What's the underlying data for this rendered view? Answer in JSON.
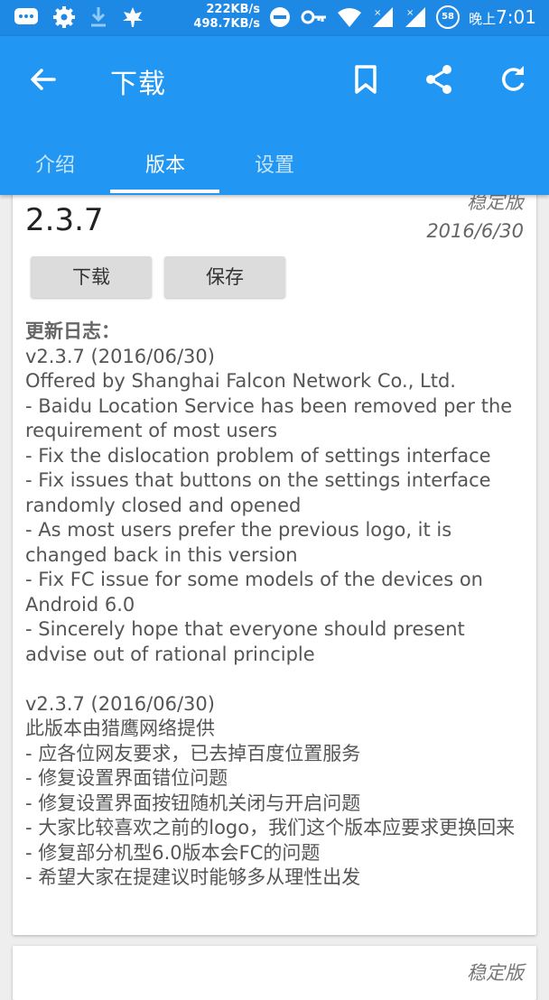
{
  "status_bar": {
    "net_up": "222KB/s",
    "net_down": "498.7KB/s",
    "battery": "58",
    "time_prefix": "晚上",
    "time": "7:01",
    "icons": [
      "chat-icon",
      "settings-icon",
      "download-icon",
      "leaf-icon",
      "dnd-icon",
      "key-icon",
      "wifi-icon",
      "signal-icon",
      "signal-icon"
    ]
  },
  "app_bar": {
    "title": "下载",
    "icons": [
      "back-arrow-icon",
      "bookmark-icon",
      "share-icon",
      "refresh-icon"
    ]
  },
  "tabs": [
    {
      "label": "介绍"
    },
    {
      "label": "版本"
    },
    {
      "label": "设置"
    }
  ],
  "release": {
    "stability": "稳定版",
    "version": "2.3.7",
    "date": "2016/6/30",
    "download_label": "下载",
    "save_label": "保存",
    "changelog_title": "更新日志：",
    "lines": [
      "v2.3.7 (2016/06/30)",
      "Offered by Shanghai Falcon Network Co., Ltd.",
      "- Baidu Location Service has been removed per the requirement of most users",
      "- Fix the dislocation problem of settings interface",
      "- Fix issues that buttons on the settings interface randomly closed and opened",
      "- As most users prefer the previous logo, it is changed back in this version",
      "- Fix FC issue for some models of the devices on Android 6.0",
      "- Sincerely hope that everyone should present advise out of rational principle",
      "",
      "v2.3.7 (2016/06/30)",
      "此版本由猎鹰网络提供",
      "- 应各位网友要求，已去掉百度位置服务",
      "- 修复设置界面错位问题",
      "- 修复设置界面按钮随机关闭与开启问题",
      "- 大家比较喜欢之前的logo，我们这个版本应要求更换回来",
      "- 修复部分机型6.0版本会FC的问题",
      "- 希望大家在提建议时能够多从理性出发"
    ]
  },
  "next_release": {
    "stability": "稳定版"
  },
  "colors": {
    "status_bar": "#1e88e5",
    "app_bar": "#2196f3",
    "background": "#eeeeee"
  }
}
